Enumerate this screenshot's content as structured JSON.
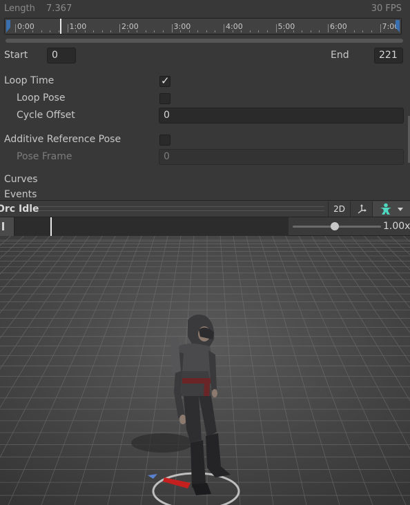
{
  "clip": {
    "length_label": "Length",
    "length_value": "7.367",
    "fps": "30 FPS",
    "timeline_labels": [
      "0:00",
      "1:00",
      "2:00",
      "3:00",
      "4:00",
      "5:00",
      "6:00",
      "7:00"
    ],
    "start_label": "Start",
    "start_value": "0",
    "end_label": "End",
    "end_value": "221"
  },
  "properties": {
    "loop_time": {
      "label": "Loop Time",
      "checked": true
    },
    "loop_pose": {
      "label": "Loop Pose",
      "checked": false
    },
    "cycle_offset": {
      "label": "Cycle Offset",
      "value": "0"
    },
    "additive_reference_pose": {
      "label": "Additive Reference Pose",
      "checked": false
    },
    "pose_frame": {
      "label": "Pose Frame",
      "value": "0"
    }
  },
  "sections": {
    "curves": "Curves",
    "events": "Events"
  },
  "preview": {
    "title": "Orc Idle",
    "btn_2d": "2D",
    "pivot_icon": "pivot-icon",
    "avatar_icon": "avatar-icon",
    "speed": "1.00x"
  },
  "colors": {
    "panel_bg": "#383838",
    "field_bg": "#2a2a2a",
    "accent_blue": "#3a6fb0",
    "avatar_teal": "#4fd8c0"
  }
}
